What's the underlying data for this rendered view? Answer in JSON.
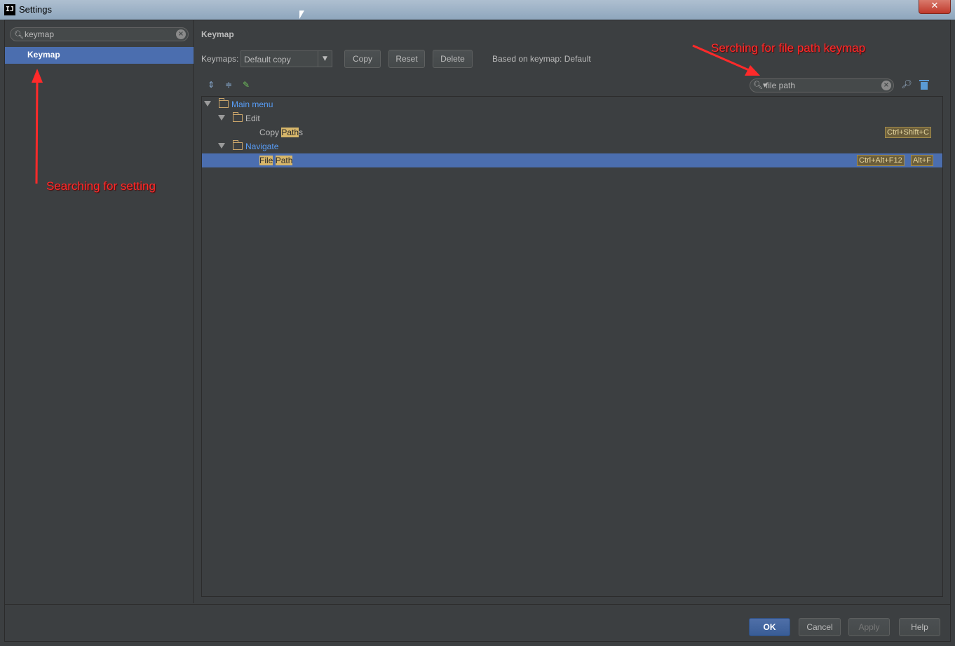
{
  "window": {
    "title": "Settings",
    "app_icon": "IJ",
    "close_label": "✕"
  },
  "sidebar": {
    "search_value": "keymap",
    "items": [
      {
        "label": "Keymap",
        "selected": true
      }
    ]
  },
  "keymap_page": {
    "title": "Keymap",
    "keymaps_label": "Keymaps:",
    "selected_keymap": "Default copy",
    "buttons": {
      "copy": "Copy",
      "reset": "Reset",
      "delete": "Delete"
    },
    "based_on": "Based on keymap: Default",
    "filter_value": "file path"
  },
  "tree": {
    "main_menu": "Main menu",
    "edit": "Edit",
    "copy_paths": {
      "pre": "Copy ",
      "hl": "Path",
      "post": "s",
      "shortcut": "Ctrl+Shift+C"
    },
    "navigate": "Navigate",
    "file_path": {
      "hl1": "File",
      "hl2": "Path",
      "shortcuts": [
        "Ctrl+Alt+F12",
        "Alt+F"
      ]
    }
  },
  "dialog_buttons": {
    "ok": "OK",
    "cancel": "Cancel",
    "apply": "Apply",
    "help": "Help"
  },
  "annotations": {
    "setting_search": "Searching for setting",
    "keymap_search": "Serching for file path keymap",
    "color": "#ff2a2a"
  },
  "colors": {
    "accent": "#4b6eaf",
    "highlight": "#d7b66a",
    "background": "#3c3f41"
  }
}
